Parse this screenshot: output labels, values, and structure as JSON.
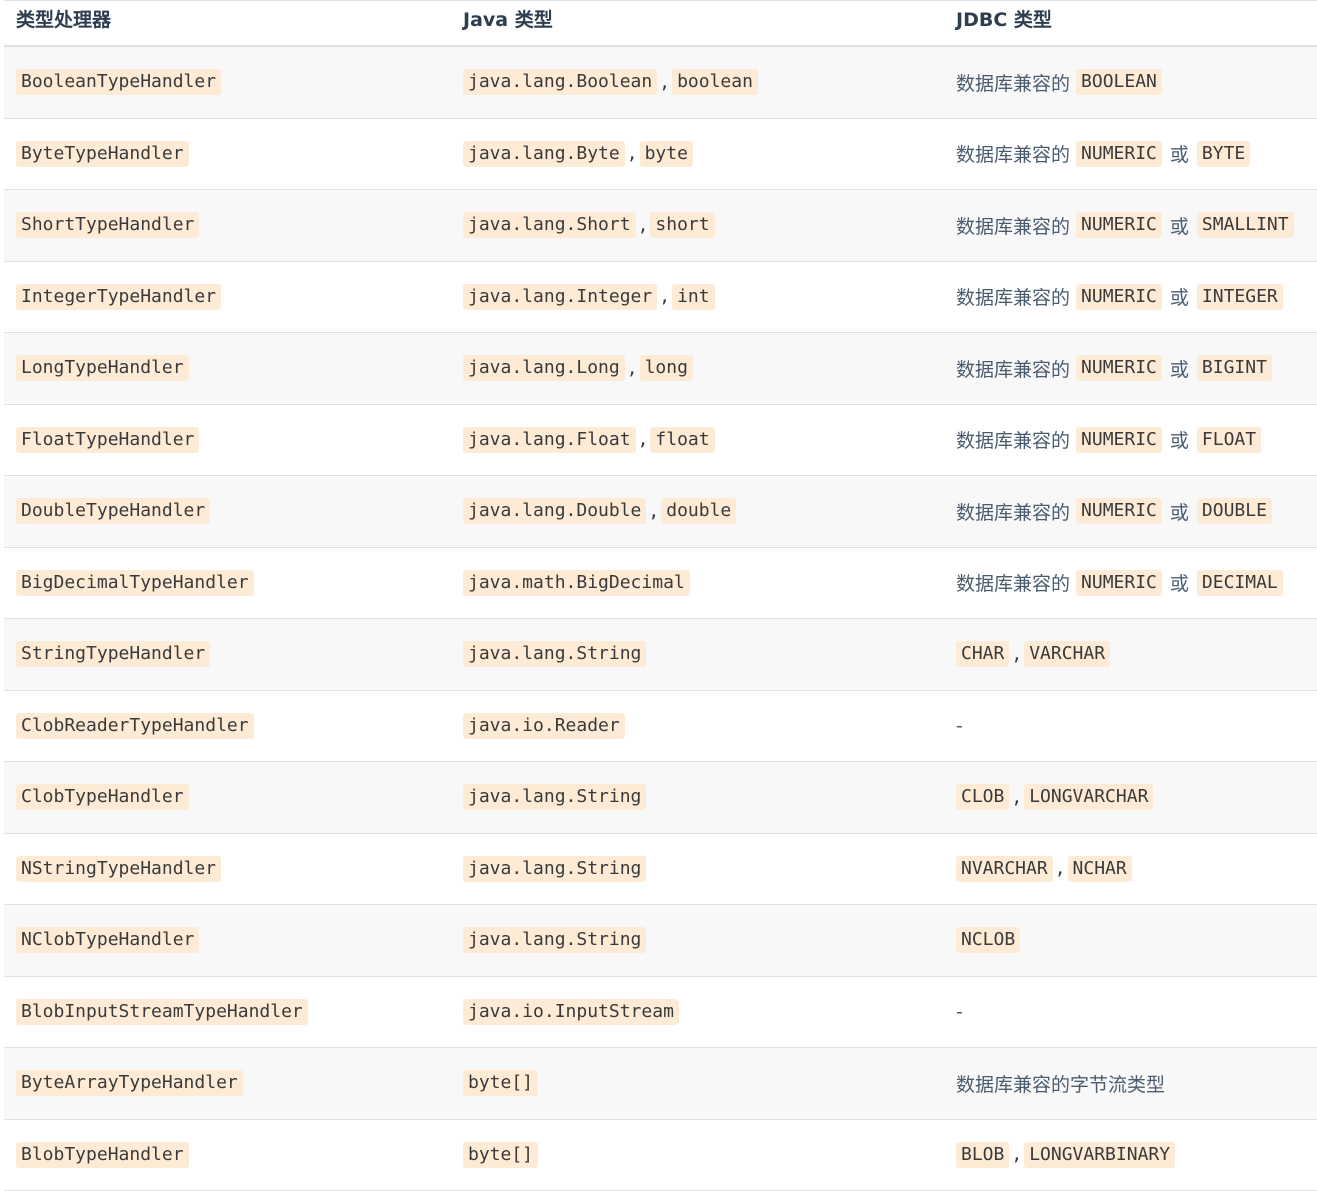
{
  "header": {
    "col1": "类型处理器",
    "col2": "Java 类型",
    "col3": "JDBC 类型"
  },
  "rows": [
    {
      "handler": "BooleanTypeHandler",
      "java": [
        "java.lang.Boolean",
        "boolean"
      ],
      "jdbc_prefix": "数据库兼容的",
      "jdbc": [
        "BOOLEAN"
      ],
      "jdbc_joiner": ""
    },
    {
      "handler": "ByteTypeHandler",
      "java": [
        "java.lang.Byte",
        "byte"
      ],
      "jdbc_prefix": "数据库兼容的",
      "jdbc": [
        "NUMERIC",
        "BYTE"
      ],
      "jdbc_joiner": "或"
    },
    {
      "handler": "ShortTypeHandler",
      "java": [
        "java.lang.Short",
        "short"
      ],
      "jdbc_prefix": "数据库兼容的",
      "jdbc": [
        "NUMERIC",
        "SMALLINT"
      ],
      "jdbc_joiner": "或"
    },
    {
      "handler": "IntegerTypeHandler",
      "java": [
        "java.lang.Integer",
        "int"
      ],
      "jdbc_prefix": "数据库兼容的",
      "jdbc": [
        "NUMERIC",
        "INTEGER"
      ],
      "jdbc_joiner": "或"
    },
    {
      "handler": "LongTypeHandler",
      "java": [
        "java.lang.Long",
        "long"
      ],
      "jdbc_prefix": "数据库兼容的",
      "jdbc": [
        "NUMERIC",
        "BIGINT"
      ],
      "jdbc_joiner": "或"
    },
    {
      "handler": "FloatTypeHandler",
      "java": [
        "java.lang.Float",
        "float"
      ],
      "jdbc_prefix": "数据库兼容的",
      "jdbc": [
        "NUMERIC",
        "FLOAT"
      ],
      "jdbc_joiner": "或"
    },
    {
      "handler": "DoubleTypeHandler",
      "java": [
        "java.lang.Double",
        "double"
      ],
      "jdbc_prefix": "数据库兼容的",
      "jdbc": [
        "NUMERIC",
        "DOUBLE"
      ],
      "jdbc_joiner": "或"
    },
    {
      "handler": "BigDecimalTypeHandler",
      "java": [
        "java.math.BigDecimal"
      ],
      "jdbc_prefix": "数据库兼容的",
      "jdbc": [
        "NUMERIC",
        "DECIMAL"
      ],
      "jdbc_joiner": "或"
    },
    {
      "handler": "StringTypeHandler",
      "java": [
        "java.lang.String"
      ],
      "jdbc_prefix": "",
      "jdbc": [
        "CHAR",
        "VARCHAR"
      ],
      "jdbc_joiner": ","
    },
    {
      "handler": "ClobReaderTypeHandler",
      "java": [
        "java.io.Reader"
      ],
      "jdbc_prefix": "",
      "jdbc_text": "-",
      "jdbc": [],
      "jdbc_joiner": ""
    },
    {
      "handler": "ClobTypeHandler",
      "java": [
        "java.lang.String"
      ],
      "jdbc_prefix": "",
      "jdbc": [
        "CLOB",
        "LONGVARCHAR"
      ],
      "jdbc_joiner": ","
    },
    {
      "handler": "NStringTypeHandler",
      "java": [
        "java.lang.String"
      ],
      "jdbc_prefix": "",
      "jdbc": [
        "NVARCHAR",
        "NCHAR"
      ],
      "jdbc_joiner": ","
    },
    {
      "handler": "NClobTypeHandler",
      "java": [
        "java.lang.String"
      ],
      "jdbc_prefix": "",
      "jdbc": [
        "NCLOB"
      ],
      "jdbc_joiner": ""
    },
    {
      "handler": "BlobInputStreamTypeHandler",
      "java": [
        "java.io.InputStream"
      ],
      "jdbc_prefix": "",
      "jdbc_text": "-",
      "jdbc": [],
      "jdbc_joiner": ""
    },
    {
      "handler": "ByteArrayTypeHandler",
      "java": [
        "byte[]"
      ],
      "jdbc_prefix": "",
      "jdbc_text": "数据库兼容的字节流类型",
      "jdbc": [],
      "jdbc_joiner": ""
    },
    {
      "handler": "BlobTypeHandler",
      "java": [
        "byte[]"
      ],
      "jdbc_prefix": "",
      "jdbc": [
        "BLOB",
        "LONGVARBINARY"
      ],
      "jdbc_joiner": ","
    }
  ]
}
